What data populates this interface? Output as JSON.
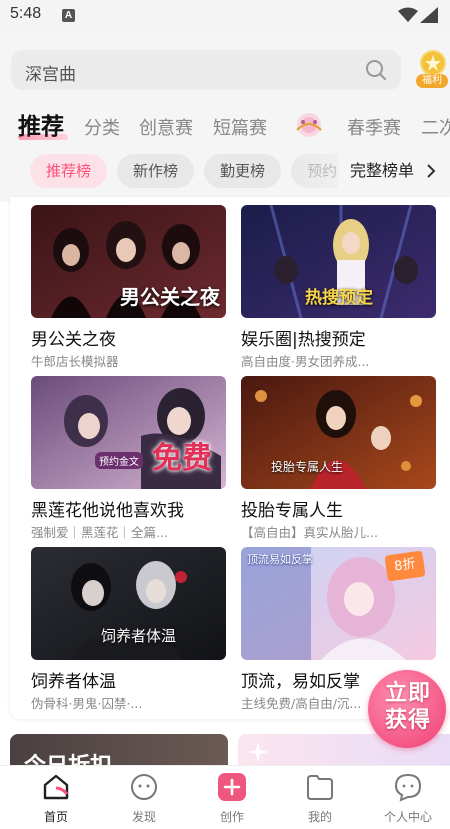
{
  "status_bar": {
    "time": "5:48",
    "notification_letter": "A"
  },
  "search": {
    "placeholder": "深宫曲"
  },
  "welfare": {
    "label": "福利"
  },
  "tabs": [
    {
      "label": "推荐",
      "active": true
    },
    {
      "label": "分类"
    },
    {
      "label": "创意赛"
    },
    {
      "label": "短篇赛"
    },
    {
      "label": "春季赛"
    },
    {
      "label": "二次"
    }
  ],
  "chips": [
    {
      "label": "推荐榜",
      "active": true
    },
    {
      "label": "新作榜"
    },
    {
      "label": "勤更榜"
    },
    {
      "label": "预约榜"
    }
  ],
  "full_rank": {
    "label": "完整榜单"
  },
  "cards": [
    {
      "title": "男公关之夜",
      "subtitle": "牛郎店长模拟器",
      "cover_text": "男公关之夜"
    },
    {
      "title": "娱乐圈|热搜预定",
      "subtitle": "高自由度·男女团养成...",
      "cover_text": "热搜预定"
    },
    {
      "title": "黑莲花他说他喜欢我",
      "subtitle": "强制爱｜黑莲花｜全篇...",
      "cover_text": "免费",
      "cover_badge": "预约金文"
    },
    {
      "title": "投胎专属人生",
      "subtitle": "【高自由】真实从胎儿...",
      "cover_text": "投胎专属人生"
    },
    {
      "title": "饲养者体温",
      "subtitle": "伪骨科·男鬼·囚禁·...",
      "cover_text": "饲养者体温"
    },
    {
      "title": "顶流，易如反掌",
      "subtitle": "主线免费/高自由/沉...",
      "cover_text": "顶流易如反掌",
      "discount": "8折"
    }
  ],
  "peek": {
    "left_title": "今日折扣"
  },
  "promo": {
    "label": "立即获得"
  },
  "bottom_nav": [
    {
      "label": "首页",
      "icon": "home-icon",
      "active": true
    },
    {
      "label": "发现",
      "icon": "discover-icon"
    },
    {
      "label": "创作",
      "icon": "create-icon"
    },
    {
      "label": "我的",
      "icon": "mine-icon"
    },
    {
      "label": "个人中心",
      "icon": "profile-icon"
    }
  ],
  "colors": {
    "accent": "#ff4f79",
    "chip_active_bg": "#fde1e8",
    "create_button": "#f0577f"
  }
}
